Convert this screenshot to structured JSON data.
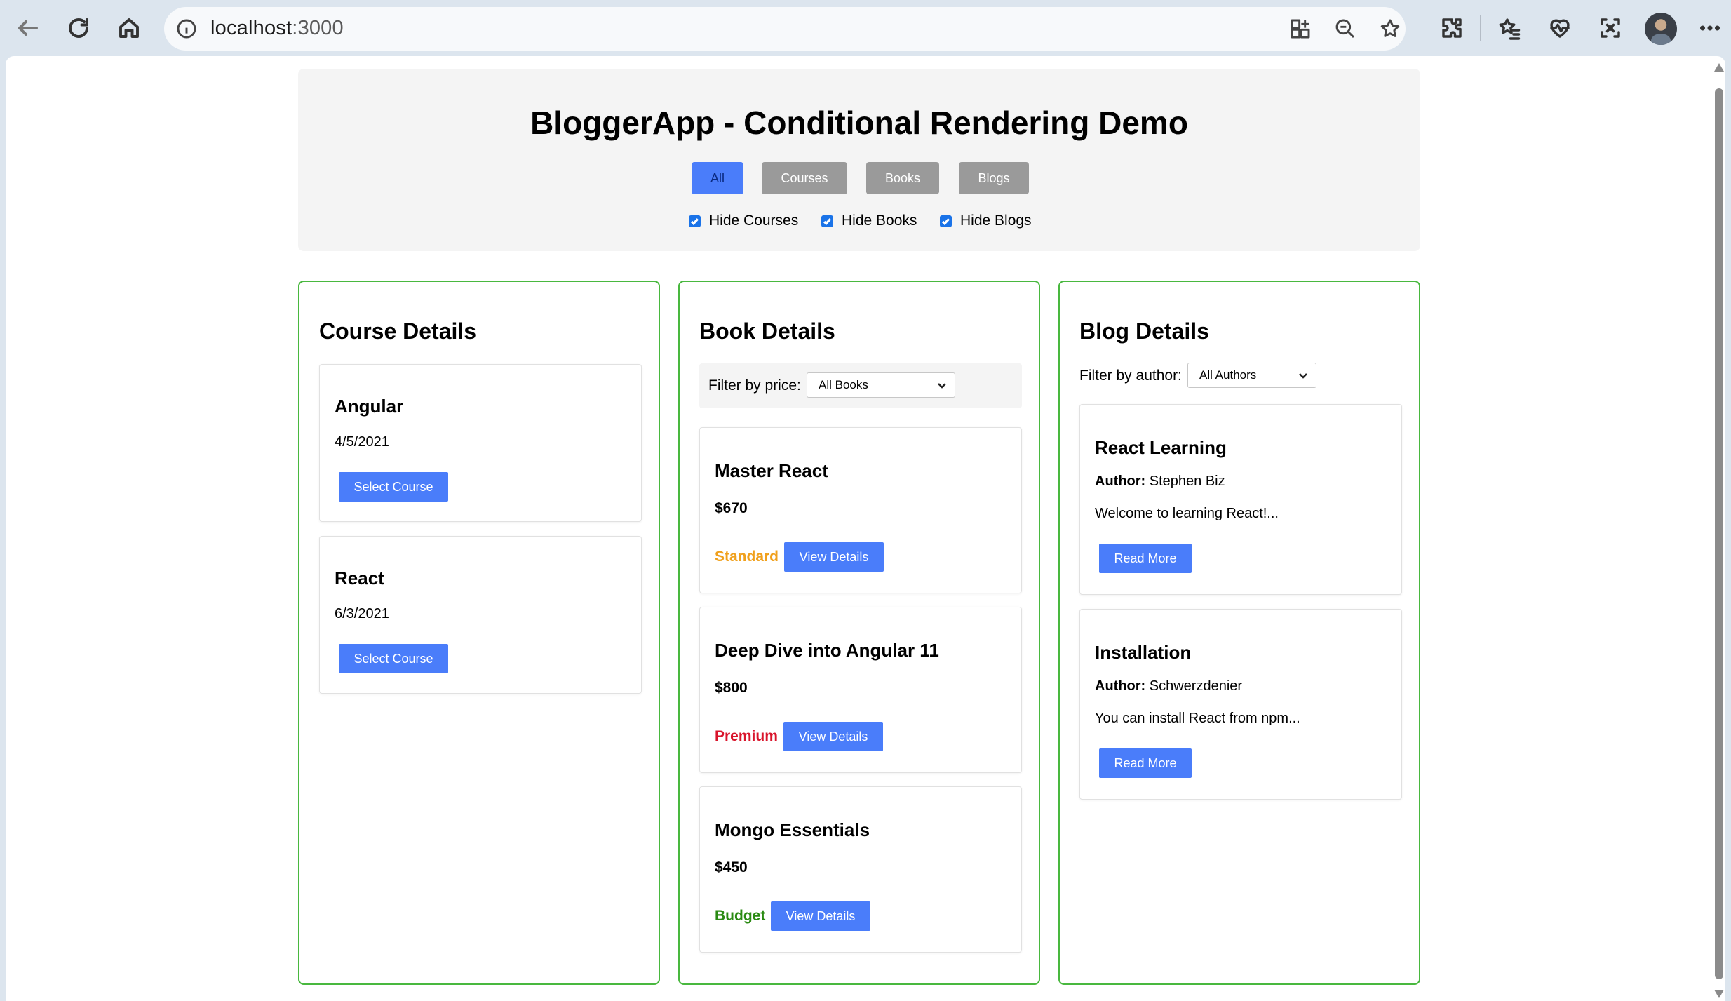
{
  "browser": {
    "url_host": "localhost",
    "url_port": ":3000"
  },
  "header": {
    "title": "BloggerApp - Conditional Rendering Demo",
    "filter_buttons": [
      {
        "label": "All",
        "active": true
      },
      {
        "label": "Courses",
        "active": false
      },
      {
        "label": "Books",
        "active": false
      },
      {
        "label": "Blogs",
        "active": false
      }
    ],
    "checkboxes": [
      {
        "label": "Hide Courses",
        "checked": true
      },
      {
        "label": "Hide Books",
        "checked": true
      },
      {
        "label": "Hide Blogs",
        "checked": true
      }
    ]
  },
  "courses": {
    "title": "Course Details",
    "items": [
      {
        "name": "Angular",
        "date": "4/5/2021",
        "button": "Select Course"
      },
      {
        "name": "React",
        "date": "6/3/2021",
        "button": "Select Course"
      }
    ]
  },
  "books": {
    "title": "Book Details",
    "filter_label": "Filter by price:",
    "filter_value": "All Books",
    "items": [
      {
        "name": "Master React",
        "price": "$670",
        "tier": "Standard",
        "tier_color": "#f0a01c",
        "button": "View Details"
      },
      {
        "name": "Deep Dive into Angular 11",
        "price": "$800",
        "tier": "Premium",
        "tier_color": "#d9142b",
        "button": "View Details"
      },
      {
        "name": "Mongo Essentials",
        "price": "$450",
        "tier": "Budget",
        "tier_color": "#2a8a12",
        "button": "View Details"
      }
    ]
  },
  "blogs": {
    "title": "Blog Details",
    "filter_label": "Filter by author:",
    "filter_value": "All Authors",
    "author_label": "Author:",
    "items": [
      {
        "name": "React Learning",
        "author": "Stephen Biz",
        "excerpt": "Welcome to learning React!...",
        "button": "Read More"
      },
      {
        "name": "Installation",
        "author": "Schwerzdenier",
        "excerpt": "You can install React from npm...",
        "button": "Read More"
      }
    ]
  },
  "colors": {
    "accent_blue": "#4a7dfa",
    "panel_border": "#49b83f",
    "inactive_button": "#9a9a9a"
  }
}
